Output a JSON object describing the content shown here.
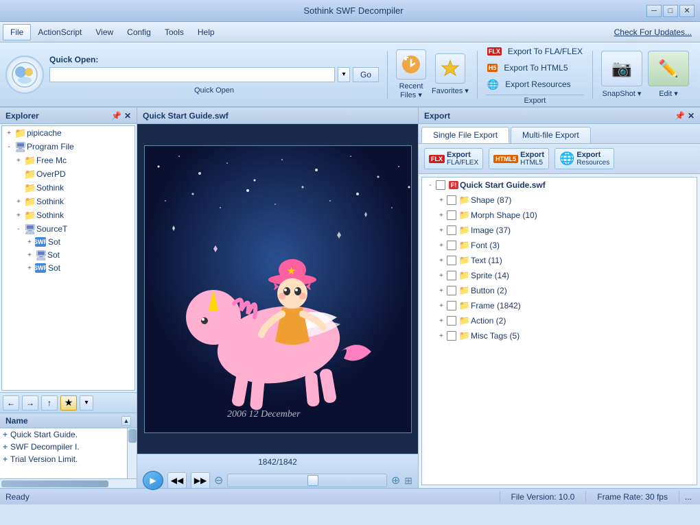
{
  "titleBar": {
    "title": "Sothink SWF Decompiler",
    "minBtn": "─",
    "maxBtn": "□",
    "closeBtn": "✕"
  },
  "menuBar": {
    "items": [
      "File",
      "ActionScript",
      "View",
      "Config",
      "Tools",
      "Help"
    ],
    "activeItem": "File",
    "checkUpdates": "Check For Updates..."
  },
  "toolbar": {
    "quickOpenLabel": "Quick Open:",
    "goBtn": "Go",
    "quickOpenSectionLabel": "Quick Open",
    "recentLabel": "Recent\nFiles ▾",
    "favoritesLabel": "Favorites\n▾",
    "exportFlaLabel": "Export To FLA/FLEX",
    "exportHtmlLabel": "Export To HTML5",
    "exportResLabel": "Export Resources",
    "exportSectionLabel": "Export",
    "snapshotLabel": "SnapShot\n▾",
    "editLabel": "Edit\n▾",
    "snapSectionLabel": "SnapShot"
  },
  "explorer": {
    "title": "Explorer",
    "treeItems": [
      {
        "indent": 0,
        "expand": "+",
        "icon": "folder",
        "label": "pipicache",
        "hasCheck": false
      },
      {
        "indent": 0,
        "expand": "-",
        "icon": "special",
        "label": "Program File",
        "hasCheck": false
      },
      {
        "indent": 1,
        "expand": "+",
        "icon": "folder",
        "label": "Free Mc",
        "hasCheck": false
      },
      {
        "indent": 1,
        "expand": "",
        "icon": "folder",
        "label": "OverPD",
        "hasCheck": false
      },
      {
        "indent": 1,
        "expand": "",
        "icon": "folder",
        "label": "Sothink",
        "hasCheck": false
      },
      {
        "indent": 1,
        "expand": "+",
        "icon": "folder",
        "label": "Sothink",
        "hasCheck": false
      },
      {
        "indent": 1,
        "expand": "+",
        "icon": "folder",
        "label": "Sothink",
        "hasCheck": false
      },
      {
        "indent": 1,
        "expand": "-",
        "icon": "special",
        "label": "SourceT",
        "hasCheck": false
      },
      {
        "indent": 2,
        "expand": "+",
        "icon": "swf",
        "label": "Sot",
        "hasCheck": false
      },
      {
        "indent": 2,
        "expand": "+",
        "icon": "special2",
        "label": "Sot",
        "hasCheck": false
      },
      {
        "indent": 2,
        "expand": "+",
        "icon": "swf",
        "label": "Sot",
        "hasCheck": false
      }
    ]
  },
  "fileList": {
    "header": "Name",
    "items": [
      {
        "label": "Quick Start Guide.",
        "icon": "+"
      },
      {
        "label": "SWF Decompiler I.",
        "icon": "+"
      },
      {
        "label": "Trial Version Limit.",
        "icon": "+"
      }
    ]
  },
  "preview": {
    "title": "Quick Start Guide.swf",
    "frameCounter": "1842/1842",
    "date": "2006  12   December",
    "watermark": ""
  },
  "exportPanel": {
    "title": "Export",
    "tabs": [
      "Single File Export",
      "Multi-file Export"
    ],
    "activeTab": "Single File Export",
    "buttons": [
      {
        "icon": "FLX",
        "label": "Export",
        "sub": "FLA/FLEX",
        "color": "#cc2020"
      },
      {
        "icon": "H5",
        "label": "Export",
        "sub": "HTML5",
        "color": "#e06000"
      },
      {
        "icon": "📁",
        "label": "Export",
        "sub": "Resources",
        "color": "#4488dd"
      }
    ],
    "treeItems": [
      {
        "indent": 0,
        "expand": "-",
        "hasCheck": true,
        "icon": "red",
        "label": "Quick Start Guide.swf",
        "bold": true
      },
      {
        "indent": 1,
        "expand": "+",
        "hasCheck": true,
        "icon": "folder",
        "label": "Shape (87)"
      },
      {
        "indent": 1,
        "expand": "+",
        "hasCheck": true,
        "icon": "folder",
        "label": "Morph Shape (10)"
      },
      {
        "indent": 1,
        "expand": "+",
        "hasCheck": true,
        "icon": "folder",
        "label": "Image (37)"
      },
      {
        "indent": 1,
        "expand": "+",
        "hasCheck": true,
        "icon": "folder",
        "label": "Font (3)"
      },
      {
        "indent": 1,
        "expand": "+",
        "hasCheck": true,
        "icon": "folder",
        "label": "Text (11)"
      },
      {
        "indent": 1,
        "expand": "+",
        "hasCheck": true,
        "icon": "folder",
        "label": "Sprite (14)"
      },
      {
        "indent": 1,
        "expand": "+",
        "hasCheck": true,
        "icon": "folder",
        "label": "Button (2)"
      },
      {
        "indent": 1,
        "expand": "+",
        "hasCheck": true,
        "icon": "folder",
        "label": "Frame (1842)"
      },
      {
        "indent": 1,
        "expand": "+",
        "hasCheck": true,
        "icon": "folder",
        "label": "Action (2)"
      },
      {
        "indent": 1,
        "expand": "+",
        "hasCheck": true,
        "icon": "folder",
        "label": "Misc Tags (5)"
      }
    ]
  },
  "statusBar": {
    "status": "Ready",
    "fileVersion": "File Version: 10.0",
    "frameRate": "Frame Rate: 30 fps",
    "dots": "..."
  }
}
